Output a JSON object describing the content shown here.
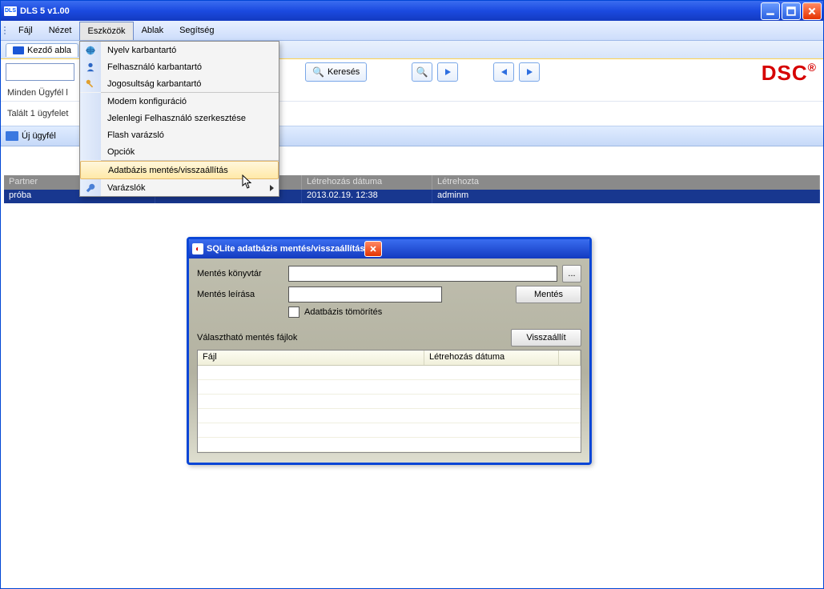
{
  "title": "DLS 5 v1.00",
  "app_icon_text": "DLS",
  "menubar": [
    "Fájl",
    "Nézet",
    "Eszközök",
    "Ablak",
    "Segítség"
  ],
  "menubar_open_index": 2,
  "dropdown": {
    "items": [
      "Nyelv karbantartó",
      "Felhasználó karbantartó",
      "Jogosultság karbantartó",
      "Modem konfiguráció",
      "Jelenlegi Felhasználó szerkesztése",
      "Flash varázsló",
      "Opciók",
      "Adatbázis mentés/visszaállítás",
      "Varázslók"
    ],
    "highlighted_index": 7,
    "has_submenu_index": 8
  },
  "subtab_label": "Kezdő abla",
  "search_button": "Keresés",
  "brand": "DSC",
  "info_line1": "Minden Ügyfél l",
  "info_line2": "Talált 1 ügyfelet",
  "new_client": "Új ügyfél",
  "grid": {
    "headers": [
      "Partner",
      "",
      "Létrehozás dátuma",
      "Létrehozta"
    ],
    "row": [
      "próba",
      "",
      "2013.02.19. 12:38",
      "adminm"
    ]
  },
  "dialog": {
    "title": "SQLite adatbázis mentés/visszaállítás",
    "dir_label": "Mentés könyvtár",
    "desc_label": "Mentés leírása",
    "browse": "...",
    "save": "Mentés",
    "compress": "Adatbázis tömörítés",
    "avail_label": "Választható mentés fájlok",
    "restore": "Visszaállít",
    "cols": [
      "Fájl",
      "Létrehozás dátuma"
    ]
  }
}
